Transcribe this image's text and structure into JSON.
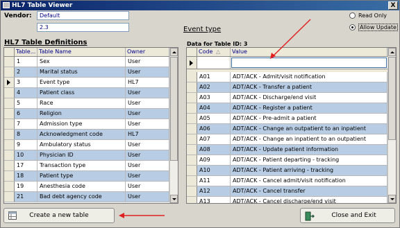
{
  "window": {
    "title": "HL7 Table Viewer",
    "close_label": "X"
  },
  "vendor": {
    "label": "Vendor:",
    "name": "Default",
    "version": "2.3"
  },
  "mode": {
    "read_only_label": "Read Only",
    "allow_update_label": "Allow Update",
    "selected": "allow_update"
  },
  "event_type_label": "Event type",
  "definitions": {
    "title": "HL7 Table Definitions",
    "columns": [
      "Table...",
      "Table Name",
      "Owner"
    ],
    "rows": [
      {
        "id": "1",
        "name": "Sex",
        "owner": "User"
      },
      {
        "id": "2",
        "name": "Marital status",
        "owner": "User"
      },
      {
        "id": "3",
        "name": "Event type",
        "owner": "HL7"
      },
      {
        "id": "4",
        "name": "Patient class",
        "owner": "User"
      },
      {
        "id": "5",
        "name": "Race",
        "owner": "User"
      },
      {
        "id": "6",
        "name": "Religion",
        "owner": "User"
      },
      {
        "id": "7",
        "name": "Admission type",
        "owner": "User"
      },
      {
        "id": "8",
        "name": "Acknowledgment code",
        "owner": "HL7"
      },
      {
        "id": "9",
        "name": "Ambulatory status",
        "owner": "User"
      },
      {
        "id": "10",
        "name": "Physician ID",
        "owner": "User"
      },
      {
        "id": "17",
        "name": "Transaction type",
        "owner": "User"
      },
      {
        "id": "18",
        "name": "Patient type",
        "owner": "User"
      },
      {
        "id": "19",
        "name": "Anesthesia code",
        "owner": "User"
      },
      {
        "id": "21",
        "name": "Bad debt agency code",
        "owner": "User"
      }
    ],
    "selected_index": 2
  },
  "table_data": {
    "title": "Data for Table ID: 3",
    "columns": [
      "Code",
      "Value"
    ],
    "sort_indicator": "△",
    "rows": [
      {
        "code": "A01",
        "value": "ADT/ACK - Admit/visit notification"
      },
      {
        "code": "A02",
        "value": "ADT/ACK - Transfer a patient"
      },
      {
        "code": "A03",
        "value": "ADT/ACK - Discharge/end visit"
      },
      {
        "code": "A04",
        "value": "ADT/ACK - Register a patient"
      },
      {
        "code": "A05",
        "value": "ADT/ACK - Pre-admit a patient"
      },
      {
        "code": "A06",
        "value": "ADT/ACK - Change an outpatient to an inpatient"
      },
      {
        "code": "A07",
        "value": "ADT/ACK - Change an inpatient to an outpatient"
      },
      {
        "code": "A08",
        "value": "ADT/ACK - Update patient information"
      },
      {
        "code": "A09",
        "value": "ADT/ACK - Patient departing - tracking"
      },
      {
        "code": "A10",
        "value": "ADT/ACK - Patient arriving - tracking"
      },
      {
        "code": "A11",
        "value": "ADT/ACK - Cancel admit/visit notification"
      },
      {
        "code": "A12",
        "value": "ADT/ACK - Cancel transfer"
      },
      {
        "code": "A13",
        "value": "ADT/ACK - Cancel discharge/end visit"
      }
    ]
  },
  "buttons": {
    "create": "Create a new table",
    "close_exit": "Close and Exit"
  },
  "colors": {
    "row_alt": "#b8cce4",
    "annotation_arrow": "#e02020"
  }
}
